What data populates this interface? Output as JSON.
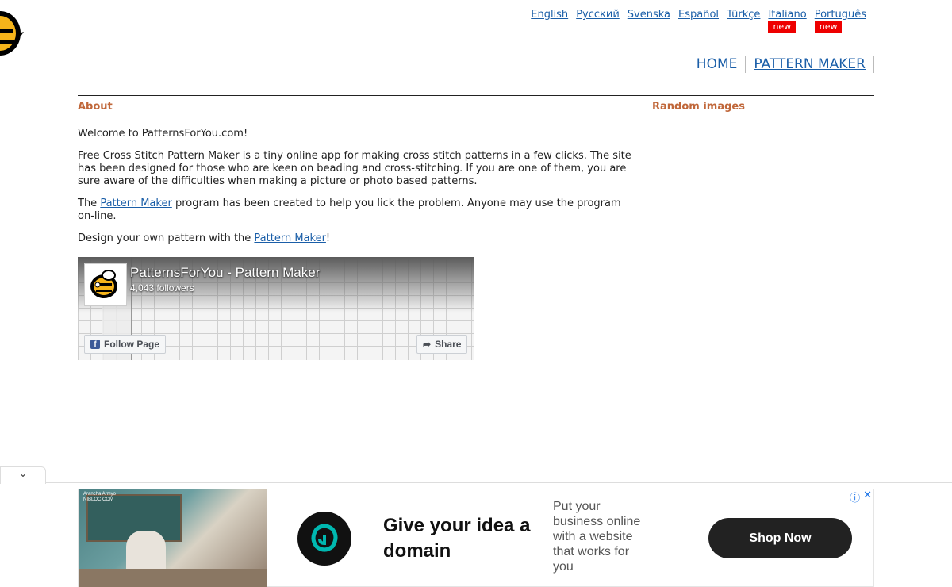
{
  "languages": [
    {
      "label": "English",
      "new": ""
    },
    {
      "label": "Русский",
      "new": ""
    },
    {
      "label": "Svenska",
      "new": ""
    },
    {
      "label": "Español",
      "new": ""
    },
    {
      "label": "Türkçe",
      "new": ""
    },
    {
      "label": "Italiano",
      "new": "new"
    },
    {
      "label": "Português",
      "new": "new"
    }
  ],
  "nav": {
    "home": "HOME",
    "pattern_maker": "PATTERN MAKER"
  },
  "about": {
    "heading": "About",
    "welcome": "Welcome to PatternsForYou.com!",
    "intro": "Free Cross Stitch Pattern Maker is a tiny online app for making cross stitch patterns in a few clicks. The site has been designed for those who are keen on beading and cross-stitching. If you are one of them, you are sure aware of the difficulties when making a picture or photo based patterns.",
    "p2_before": "The ",
    "p2_link": "Pattern Maker",
    "p2_after": " program has been created to help you lick the problem. Anyone may use the program on-line.",
    "p3_before": "Design your own pattern with the ",
    "p3_link": "Pattern Maker",
    "p3_after": "!"
  },
  "random_images": {
    "heading": "Random images"
  },
  "facebook": {
    "page_name": "PatternsForYou - Pattern Maker",
    "followers": "4,043 followers",
    "follow_label": "Follow Page",
    "share_label": "Share"
  },
  "ad": {
    "photo_caption": "Arancha Armyo\nNIBLOC.COM",
    "headline": "Give your idea a domain",
    "body": "Put your business online with a website that works for you",
    "cta": "Shop Now",
    "colors": {
      "cta_bg": "#222222",
      "logo_accent": "#00b8b0"
    }
  },
  "icons": [
    "bee-logo-icon",
    "facebook-icon",
    "share-arrow-icon",
    "chevron-down-icon",
    "ad-info-icon",
    "ad-close-icon",
    "godaddy-logo-icon"
  ]
}
